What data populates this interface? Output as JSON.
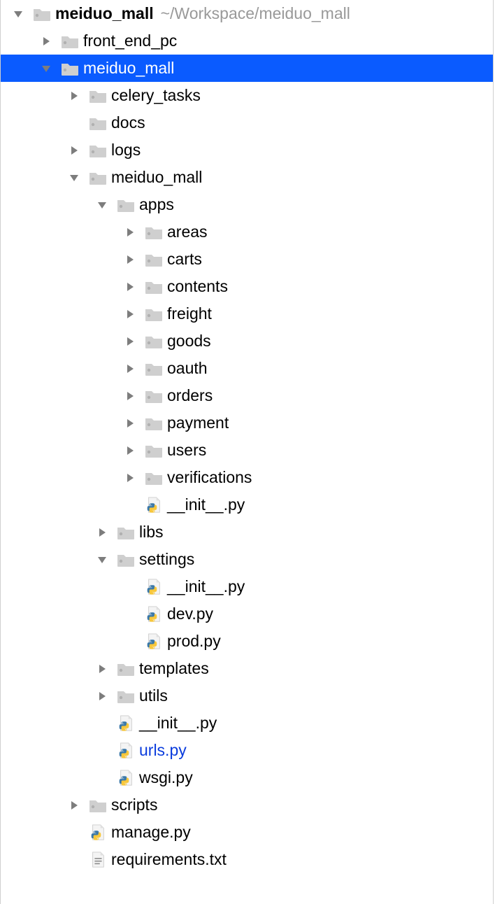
{
  "base_indent": 18,
  "step_indent": 40,
  "nodes": [
    {
      "depth": 0,
      "arrow": "down",
      "icon": "folder-gray",
      "label": "meiduo_mall",
      "bold": true,
      "trailing": "~/Workspace/meiduo_mall"
    },
    {
      "depth": 1,
      "arrow": "right",
      "icon": "folder-gray",
      "label": "front_end_pc"
    },
    {
      "depth": 1,
      "arrow": "down",
      "icon": "folder-blue",
      "label": "meiduo_mall",
      "selected": true
    },
    {
      "depth": 2,
      "arrow": "right",
      "icon": "folder-gray",
      "label": "celery_tasks"
    },
    {
      "depth": 2,
      "arrow": "none",
      "icon": "folder-gray",
      "label": "docs"
    },
    {
      "depth": 2,
      "arrow": "right",
      "icon": "folder-gray",
      "label": "logs"
    },
    {
      "depth": 2,
      "arrow": "down",
      "icon": "folder-gray",
      "label": "meiduo_mall"
    },
    {
      "depth": 3,
      "arrow": "down",
      "icon": "folder-blue",
      "label": "apps"
    },
    {
      "depth": 4,
      "arrow": "right",
      "icon": "folder-gray",
      "label": "areas"
    },
    {
      "depth": 4,
      "arrow": "right",
      "icon": "folder-gray",
      "label": "carts"
    },
    {
      "depth": 4,
      "arrow": "right",
      "icon": "folder-gray",
      "label": "contents"
    },
    {
      "depth": 4,
      "arrow": "right",
      "icon": "folder-gray",
      "label": "freight"
    },
    {
      "depth": 4,
      "arrow": "right",
      "icon": "folder-gray",
      "label": "goods"
    },
    {
      "depth": 4,
      "arrow": "right",
      "icon": "folder-gray",
      "label": "oauth"
    },
    {
      "depth": 4,
      "arrow": "right",
      "icon": "folder-gray",
      "label": "orders"
    },
    {
      "depth": 4,
      "arrow": "right",
      "icon": "folder-gray",
      "label": "payment"
    },
    {
      "depth": 4,
      "arrow": "right",
      "icon": "folder-gray",
      "label": "users"
    },
    {
      "depth": 4,
      "arrow": "right",
      "icon": "folder-gray",
      "label": "verifications"
    },
    {
      "depth": 4,
      "arrow": "none",
      "icon": "pyfile",
      "label": "__init__.py"
    },
    {
      "depth": 3,
      "arrow": "right",
      "icon": "folder-gray",
      "label": "libs"
    },
    {
      "depth": 3,
      "arrow": "down",
      "icon": "folder-gray",
      "label": "settings"
    },
    {
      "depth": 4,
      "arrow": "none",
      "icon": "pyfile",
      "label": "__init__.py"
    },
    {
      "depth": 4,
      "arrow": "none",
      "icon": "pyfile",
      "label": "dev.py"
    },
    {
      "depth": 4,
      "arrow": "none",
      "icon": "pyfile",
      "label": "prod.py"
    },
    {
      "depth": 3,
      "arrow": "right",
      "icon": "folder-purple",
      "label": "templates"
    },
    {
      "depth": 3,
      "arrow": "right",
      "icon": "folder-gray",
      "label": "utils"
    },
    {
      "depth": 3,
      "arrow": "none",
      "icon": "pyfile",
      "label": "__init__.py"
    },
    {
      "depth": 3,
      "arrow": "none",
      "icon": "pyfile",
      "label": "urls.py",
      "active": true
    },
    {
      "depth": 3,
      "arrow": "none",
      "icon": "pyfile",
      "label": "wsgi.py"
    },
    {
      "depth": 2,
      "arrow": "right",
      "icon": "folder-gray",
      "label": "scripts"
    },
    {
      "depth": 2,
      "arrow": "none",
      "icon": "pyfile",
      "label": "manage.py"
    },
    {
      "depth": 2,
      "arrow": "none",
      "icon": "txtfile",
      "label": "requirements.txt"
    }
  ]
}
